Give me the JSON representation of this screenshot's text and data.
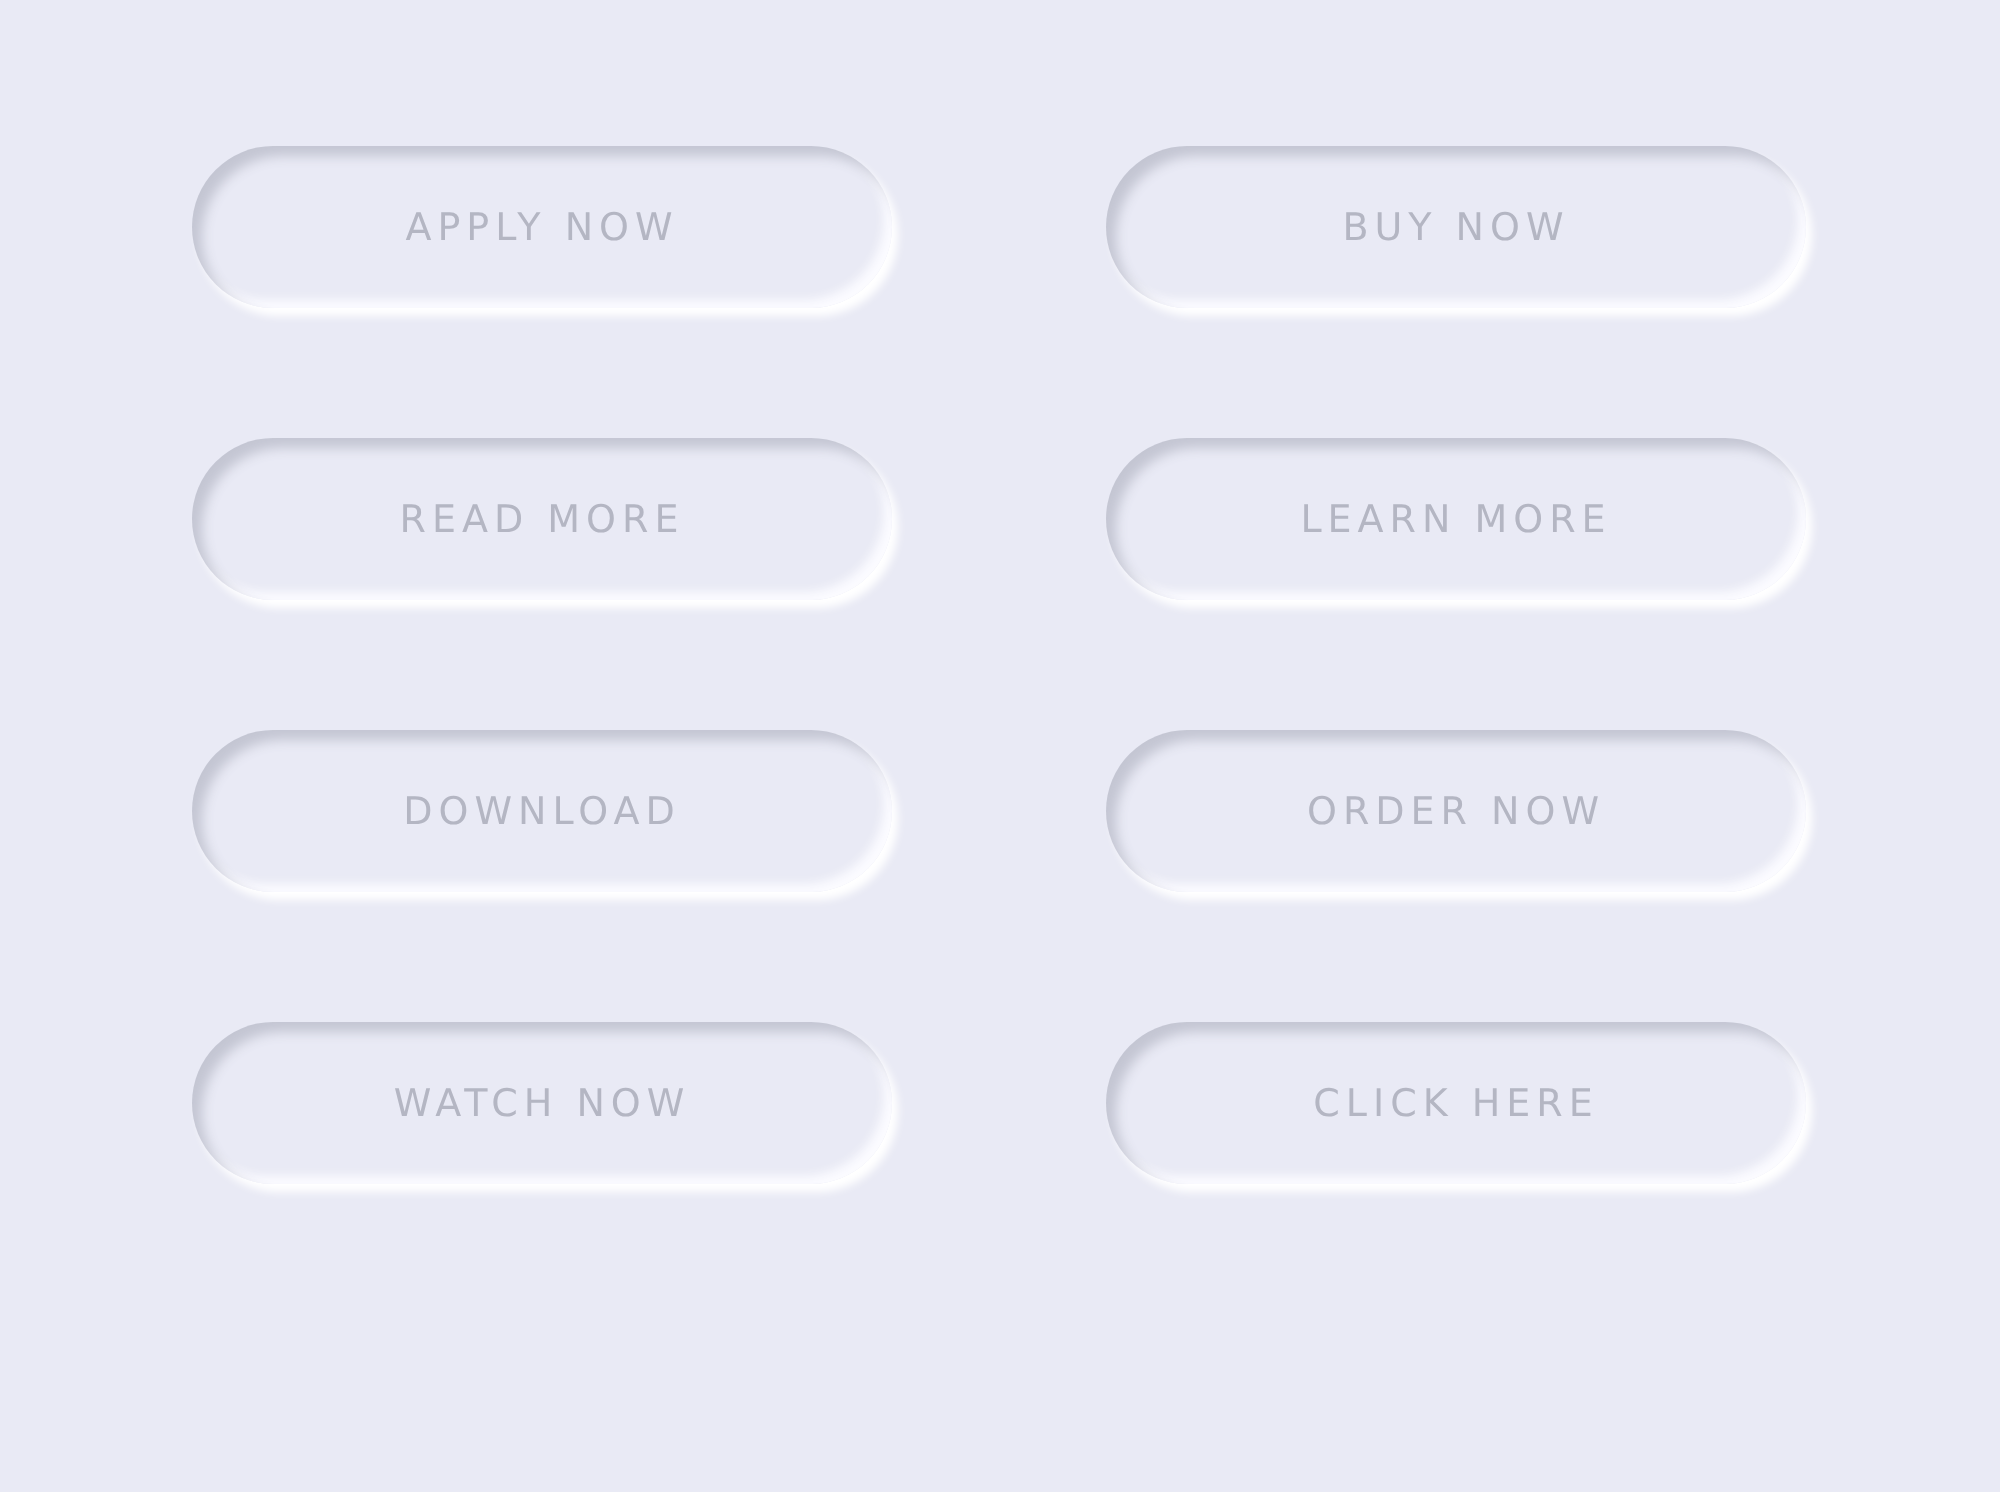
{
  "buttons": [
    {
      "label": "APPLY NOW"
    },
    {
      "label": "BUY NOW"
    },
    {
      "label": "READ MORE"
    },
    {
      "label": "LEARN MORE"
    },
    {
      "label": "DOWNLOAD"
    },
    {
      "label": "ORDER NOW"
    },
    {
      "label": "WATCH NOW"
    },
    {
      "label": "CLICK HERE"
    }
  ]
}
